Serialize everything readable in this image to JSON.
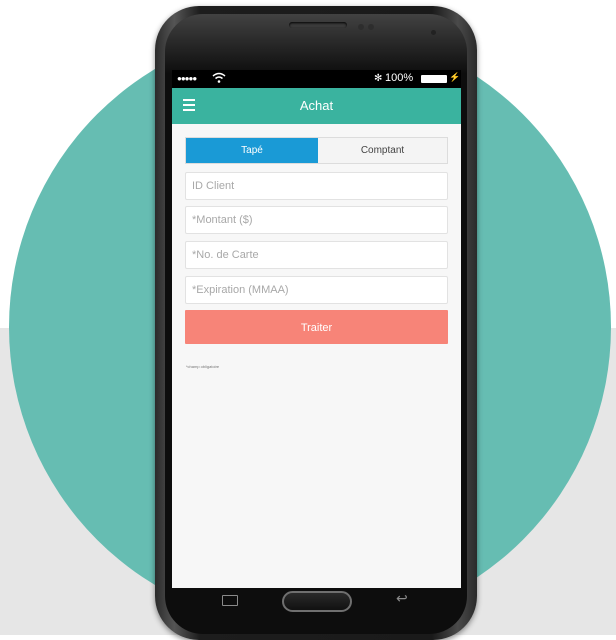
{
  "status_bar": {
    "signal": "●●●●●",
    "battery": "100%",
    "icons": [
      "wifi-icon",
      "bluetooth-icon",
      "battery-icon",
      "charging-icon"
    ]
  },
  "app_bar": {
    "title": "Achat",
    "menu_icon": "hamburger-menu-icon"
  },
  "tabs": [
    {
      "label": "Tapé",
      "active": true
    },
    {
      "label": "Comptant",
      "active": false
    }
  ],
  "fields": [
    {
      "placeholder": "ID Client",
      "value": ""
    },
    {
      "placeholder": "*Montant ($)",
      "value": ""
    },
    {
      "placeholder": "*No. de Carte",
      "value": ""
    },
    {
      "placeholder": "*Expiration (MMAA)",
      "value": ""
    }
  ],
  "submit_label": "Traiter",
  "required_note": "*champ obligatoire",
  "colors": {
    "app_bar": "#3ab39f",
    "active_tab": "#1a9ad6",
    "submit": "#f78478",
    "circle": "#66bdb2"
  },
  "nav_keys": [
    "recent-apps-icon",
    "home-button",
    "back-icon"
  ]
}
